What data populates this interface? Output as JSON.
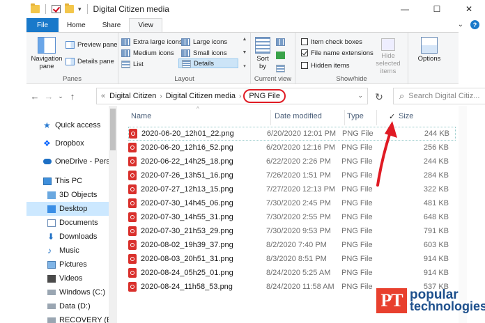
{
  "window": {
    "title": "Digital Citizen media",
    "minimize_glyph": "—",
    "maximize_glyph": "☐",
    "close_glyph": "✕",
    "qat_dropdown_glyph": "▾"
  },
  "ribbon": {
    "tabs": [
      "File",
      "Home",
      "Share",
      "View"
    ],
    "active_tab": "View",
    "collapse_glyph": "⌄",
    "help_glyph": "?",
    "groups": {
      "panes": {
        "label": "Panes",
        "navigation_pane": "Navigation pane",
        "preview_pane": "Preview pane",
        "details_pane": "Details pane"
      },
      "layout": {
        "label": "Layout",
        "items": [
          "Extra large icons",
          "Large icons",
          "Medium icons",
          "Small icons",
          "List",
          "Details"
        ],
        "selected": "Details"
      },
      "current_view": {
        "label": "Current view",
        "sort_by": "Sort by"
      },
      "show_hide": {
        "label": "Show/hide",
        "item_check_boxes": "Item check boxes",
        "file_name_extensions": "File name extensions",
        "hidden_items": "Hidden items",
        "hide_selected": "Hide selected items",
        "item_check_boxes_checked": false,
        "file_name_extensions_checked": true,
        "hidden_items_checked": false
      },
      "options": {
        "label": "Options"
      }
    }
  },
  "address": {
    "back_glyph": "←",
    "forward_glyph": "→",
    "recent_glyph": "⌄",
    "up_glyph": "↑",
    "overflow_glyph": "«",
    "separator_glyph": "›",
    "dropdown_glyph": "⌄",
    "refresh_glyph": "↻",
    "search_glyph": "⌕",
    "breadcrumbs": [
      "Digital Citizen",
      "Digital Citizen media",
      "PNG File"
    ],
    "search_placeholder": "Search Digital Citiz..."
  },
  "sidebar": {
    "items": [
      {
        "label": "Quick access",
        "icon": "star-icon"
      },
      {
        "label": "Dropbox",
        "icon": "dropbox-icon"
      },
      {
        "label": "OneDrive - Person",
        "icon": "cloud-icon"
      },
      {
        "label": "This PC",
        "icon": "computer-icon"
      },
      {
        "label": "3D Objects",
        "icon": "cube-icon"
      },
      {
        "label": "Desktop",
        "icon": "desktop-icon"
      },
      {
        "label": "Documents",
        "icon": "document-icon"
      },
      {
        "label": "Downloads",
        "icon": "download-icon"
      },
      {
        "label": "Music",
        "icon": "music-icon"
      },
      {
        "label": "Pictures",
        "icon": "picture-icon"
      },
      {
        "label": "Videos",
        "icon": "video-icon"
      },
      {
        "label": "Windows (C:)",
        "icon": "drive-icon"
      },
      {
        "label": "Data (D:)",
        "icon": "drive-icon"
      },
      {
        "label": "RECOVERY (E:)",
        "icon": "drive-icon"
      }
    ],
    "selected": "Desktop"
  },
  "file_list": {
    "columns": [
      "Name",
      "Date modified",
      "Type",
      "Size"
    ],
    "sort_caret_glyph": "^",
    "checkmark_glyph": "✓",
    "rows": [
      {
        "name": "2020-06-20_12h01_22.png",
        "date": "6/20/2020 12:01 PM",
        "type": "PNG File",
        "size": "244 KB"
      },
      {
        "name": "2020-06-20_12h16_52.png",
        "date": "6/20/2020 12:16 PM",
        "type": "PNG File",
        "size": "256 KB"
      },
      {
        "name": "2020-06-22_14h25_18.png",
        "date": "6/22/2020 2:26 PM",
        "type": "PNG File",
        "size": "244 KB"
      },
      {
        "name": "2020-07-26_13h51_16.png",
        "date": "7/26/2020 1:51 PM",
        "type": "PNG File",
        "size": "284 KB"
      },
      {
        "name": "2020-07-27_12h13_15.png",
        "date": "7/27/2020 12:13 PM",
        "type": "PNG File",
        "size": "322 KB"
      },
      {
        "name": "2020-07-30_14h45_06.png",
        "date": "7/30/2020 2:45 PM",
        "type": "PNG File",
        "size": "481 KB"
      },
      {
        "name": "2020-07-30_14h55_31.png",
        "date": "7/30/2020 2:55 PM",
        "type": "PNG File",
        "size": "648 KB"
      },
      {
        "name": "2020-07-30_21h53_29.png",
        "date": "7/30/2020 9:53 PM",
        "type": "PNG File",
        "size": "791 KB"
      },
      {
        "name": "2020-08-02_19h39_37.png",
        "date": "8/2/2020 7:40 PM",
        "type": "PNG File",
        "size": "603 KB"
      },
      {
        "name": "2020-08-03_20h51_31.png",
        "date": "8/3/2020 8:51 PM",
        "type": "PNG File",
        "size": "914 KB"
      },
      {
        "name": "2020-08-24_05h25_01.png",
        "date": "8/24/2020 5:25 AM",
        "type": "PNG File",
        "size": "914 KB"
      },
      {
        "name": "2020-08-24_11h58_53.png",
        "date": "8/24/2020 11:58 AM",
        "type": "PNG File",
        "size": "537 KB"
      }
    ]
  },
  "logo": {
    "mark": "PT",
    "line1": "popular",
    "line2": "technologies"
  },
  "colors": {
    "accent": "#1979ca",
    "annotation_red": "#e01b24",
    "selection": "#cce8ff",
    "logo_red": "#e8402e",
    "logo_blue": "#1d4f8c"
  }
}
